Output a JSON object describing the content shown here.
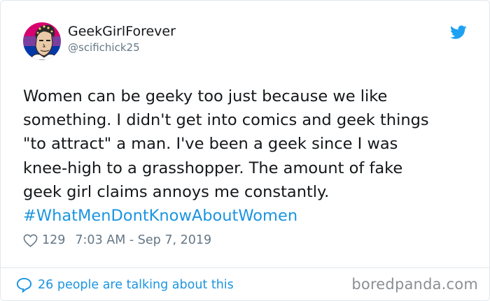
{
  "header": {
    "display_name": "GeekGirlForever",
    "handle": "@scifichick25"
  },
  "tweet": {
    "lines": [
      "Women can be geeky too just because we like",
      "something. I didn't get into comics and geek things",
      "\"to attract\" a man. I've been a geek since I was",
      "knee-high to a grasshopper. The amount of fake",
      "geek girl claims annoys me constantly."
    ],
    "hashtag": "#WhatMenDontKnowAboutWomen"
  },
  "meta": {
    "like_count": "129",
    "timestamp": "7:03 AM - Sep 7, 2019"
  },
  "footer": {
    "talking_text": "26 people are talking about this"
  },
  "watermark": "boredpanda.com",
  "icons": {
    "avatar": "avatar-illustration",
    "brand": "twitter-bird-icon",
    "like": "heart-icon",
    "reply": "speech-bubble-icon"
  },
  "colors": {
    "link_blue": "#1b95e0",
    "twitter_blue": "#1da1f2",
    "text": "#14171a",
    "muted": "#657786",
    "border": "#e1e8ed",
    "avatar_pink": "#d6006f",
    "avatar_purple": "#7b3fa0",
    "avatar_blue": "#0038a8"
  }
}
